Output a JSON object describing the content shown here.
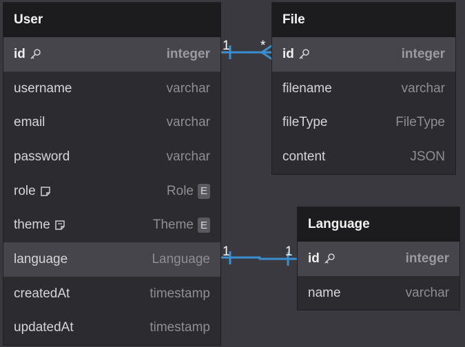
{
  "tables": {
    "user": {
      "title": "User",
      "rows": [
        {
          "name": "id",
          "type": "integer"
        },
        {
          "name": "username",
          "type": "varchar"
        },
        {
          "name": "email",
          "type": "varchar"
        },
        {
          "name": "password",
          "type": "varchar"
        },
        {
          "name": "role",
          "type": "Role",
          "badge": "E"
        },
        {
          "name": "theme",
          "type": "Theme",
          "badge": "E"
        },
        {
          "name": "language",
          "type": "Language"
        },
        {
          "name": "createdAt",
          "type": "timestamp"
        },
        {
          "name": "updatedAt",
          "type": "timestamp"
        }
      ]
    },
    "file": {
      "title": "File",
      "rows": [
        {
          "name": "id",
          "type": "integer"
        },
        {
          "name": "filename",
          "type": "varchar"
        },
        {
          "name": "fileType",
          "type": "FileType"
        },
        {
          "name": "content",
          "type": "JSON"
        }
      ]
    },
    "language": {
      "title": "Language",
      "rows": [
        {
          "name": "id",
          "type": "integer"
        },
        {
          "name": "name",
          "type": "varchar"
        }
      ]
    }
  },
  "relations": {
    "user_file": {
      "from_label": "1",
      "to_label": "*"
    },
    "user_language": {
      "from_label": "1",
      "to_label": "1"
    }
  },
  "colors": {
    "background": "#3a393f",
    "header": "#1c1c1e",
    "connector": "#3a8fd0"
  },
  "icons": {
    "primary_key": "key-icon",
    "note": "note-icon"
  }
}
